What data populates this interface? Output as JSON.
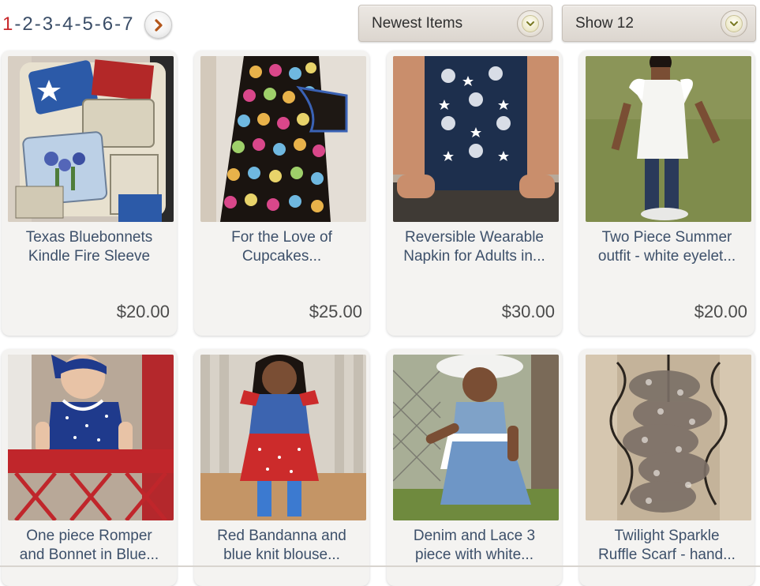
{
  "pagination": {
    "pages": [
      "1",
      "2",
      "3",
      "4",
      "5",
      "6",
      "7"
    ],
    "current": "1",
    "separator": "-",
    "next_icon": "chevron-right-icon"
  },
  "sort_select": {
    "value": "Newest Items",
    "icon": "chevron-down-icon"
  },
  "show_select": {
    "value": "Show 12",
    "icon": "chevron-down-icon"
  },
  "products": [
    {
      "title": "Texas Bluebonnets Kindle Fire Sleeve",
      "title_lines": [
        "Texas Bluebonnets",
        "Kindle Fire Sleeve"
      ],
      "price": "$20.00"
    },
    {
      "title": "For the Love of Cupcakes...",
      "title_lines": [
        "For the Love of",
        "Cupcakes..."
      ],
      "price": "$25.00"
    },
    {
      "title": "Reversible Wearable Napkin for Adults in...",
      "title_lines": [
        "Reversible Wearable",
        "Napkin for Adults in..."
      ],
      "price": "$30.00"
    },
    {
      "title": "Two Piece Summer outfit - white eyelet...",
      "title_lines": [
        "Two Piece Summer",
        "outfit - white eyelet..."
      ],
      "price": "$20.00"
    },
    {
      "title": "One piece Romper and Bonnet in Blue...",
      "title_lines": [
        "One piece Romper",
        "and Bonnet in Blue..."
      ],
      "price": ""
    },
    {
      "title": "Red Bandanna and blue knit blouse...",
      "title_lines": [
        "Red Bandanna and",
        "blue knit blouse..."
      ],
      "price": ""
    },
    {
      "title": "Denim and Lace 3 piece with white...",
      "title_lines": [
        "Denim and Lace 3",
        "piece with white..."
      ],
      "price": ""
    },
    {
      "title": "Twilight Sparkle Ruffle Scarf - hand...",
      "title_lines": [
        "Twilight Sparkle",
        "Ruffle Scarf - hand..."
      ],
      "price": ""
    }
  ],
  "colors": {
    "link_text": "#3d506a",
    "current_page": "#c8282c",
    "card_bg": "#f4f3f1",
    "select_bg": "#e3ded8"
  }
}
